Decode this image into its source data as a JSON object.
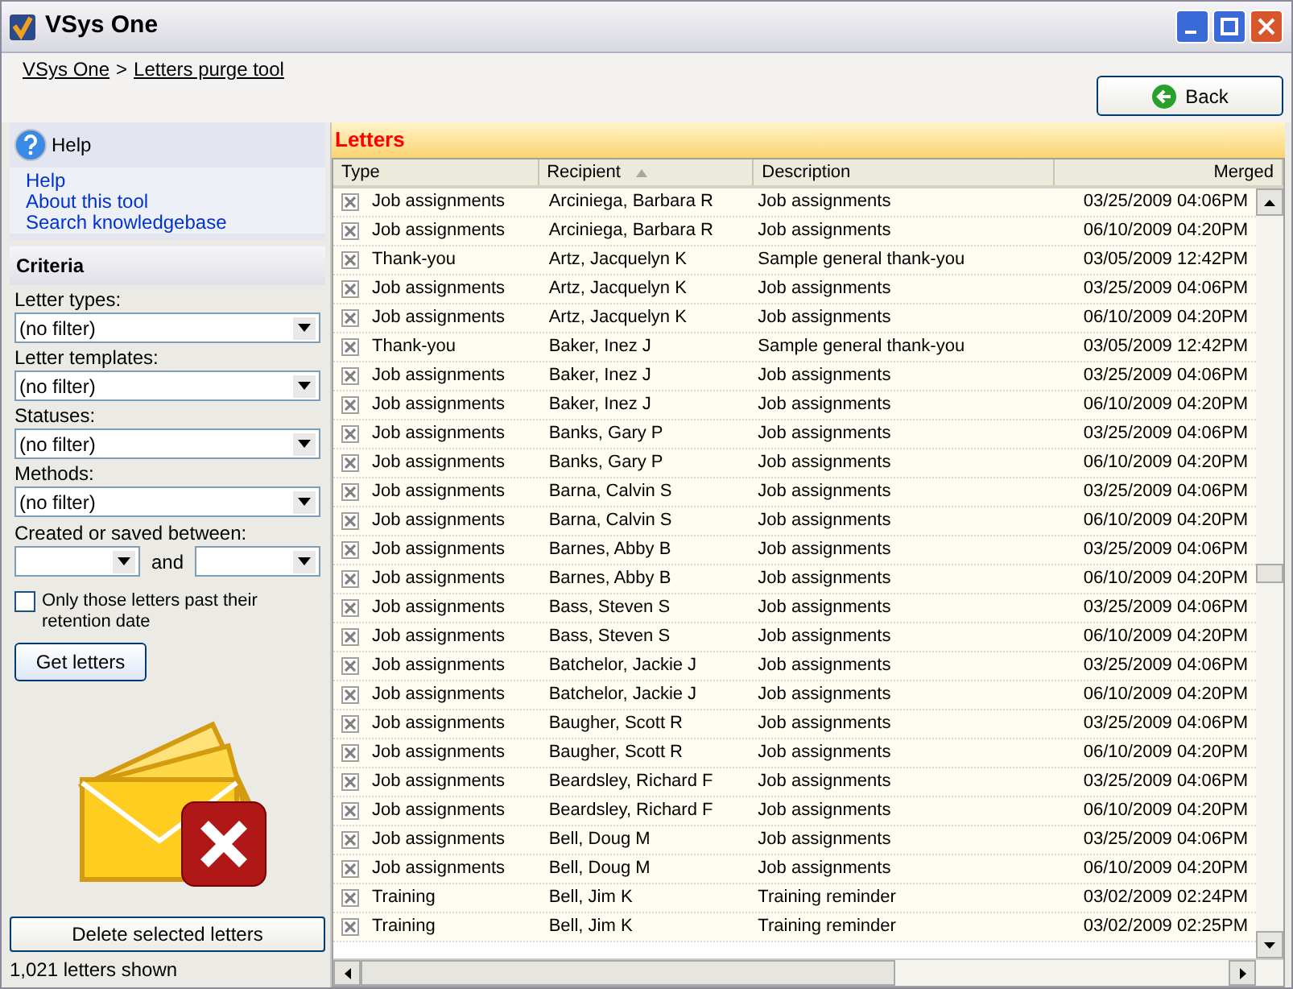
{
  "window": {
    "title": "VSys One"
  },
  "breadcrumb": [
    {
      "label": "VSys One"
    },
    {
      "label": "Letters purge tool"
    }
  ],
  "breadcrumb_separator": ">",
  "back_button": "Back",
  "help": {
    "title": "Help",
    "links": [
      "Help",
      "About this tool",
      "Search knowledgebase"
    ]
  },
  "criteria": {
    "title": "Criteria",
    "filters": [
      {
        "label": "Letter types:",
        "value": "(no filter)"
      },
      {
        "label": "Letter templates:",
        "value": "(no filter)"
      },
      {
        "label": "Statuses:",
        "value": "(no filter)"
      },
      {
        "label": "Methods:",
        "value": "(no filter)"
      }
    ],
    "date_label": "Created or saved between:",
    "date_and": "and",
    "retention": {
      "label": "Only those letters past their retention date",
      "checked": false
    },
    "get_button": "Get letters"
  },
  "delete_button": "Delete selected letters",
  "status": "1,021 letters shown",
  "letters": {
    "title": "Letters",
    "columns": [
      {
        "label": "Type",
        "sorted": false
      },
      {
        "label": "Recipient",
        "sorted": true
      },
      {
        "label": "Description",
        "sorted": false
      },
      {
        "label": "Merged",
        "sorted": false
      }
    ],
    "rows": [
      {
        "checked": true,
        "type": "Job assignments",
        "recipient": "Arciniega, Barbara R",
        "description": "Job assignments",
        "merged": "03/25/2009 04:06PM"
      },
      {
        "checked": true,
        "type": "Job assignments",
        "recipient": "Arciniega, Barbara R",
        "description": "Job assignments",
        "merged": "06/10/2009 04:20PM"
      },
      {
        "checked": true,
        "type": "Thank-you",
        "recipient": "Artz, Jacquelyn K",
        "description": "Sample general thank-you",
        "merged": "03/05/2009 12:42PM"
      },
      {
        "checked": true,
        "type": "Job assignments",
        "recipient": "Artz, Jacquelyn K",
        "description": "Job assignments",
        "merged": "03/25/2009 04:06PM"
      },
      {
        "checked": true,
        "type": "Job assignments",
        "recipient": "Artz, Jacquelyn K",
        "description": "Job assignments",
        "merged": "06/10/2009 04:20PM"
      },
      {
        "checked": true,
        "type": "Thank-you",
        "recipient": "Baker, Inez J",
        "description": "Sample general thank-you",
        "merged": "03/05/2009 12:42PM"
      },
      {
        "checked": true,
        "type": "Job assignments",
        "recipient": "Baker, Inez J",
        "description": "Job assignments",
        "merged": "03/25/2009 04:06PM"
      },
      {
        "checked": true,
        "type": "Job assignments",
        "recipient": "Baker, Inez J",
        "description": "Job assignments",
        "merged": "06/10/2009 04:20PM"
      },
      {
        "checked": true,
        "type": "Job assignments",
        "recipient": "Banks, Gary P",
        "description": "Job assignments",
        "merged": "03/25/2009 04:06PM"
      },
      {
        "checked": true,
        "type": "Job assignments",
        "recipient": "Banks, Gary P",
        "description": "Job assignments",
        "merged": "06/10/2009 04:20PM"
      },
      {
        "checked": true,
        "type": "Job assignments",
        "recipient": "Barna, Calvin S",
        "description": "Job assignments",
        "merged": "03/25/2009 04:06PM"
      },
      {
        "checked": true,
        "type": "Job assignments",
        "recipient": "Barna, Calvin S",
        "description": "Job assignments",
        "merged": "06/10/2009 04:20PM"
      },
      {
        "checked": true,
        "type": "Job assignments",
        "recipient": "Barnes, Abby B",
        "description": "Job assignments",
        "merged": "03/25/2009 04:06PM"
      },
      {
        "checked": true,
        "type": "Job assignments",
        "recipient": "Barnes, Abby B",
        "description": "Job assignments",
        "merged": "06/10/2009 04:20PM"
      },
      {
        "checked": true,
        "type": "Job assignments",
        "recipient": "Bass, Steven S",
        "description": "Job assignments",
        "merged": "03/25/2009 04:06PM"
      },
      {
        "checked": true,
        "type": "Job assignments",
        "recipient": "Bass, Steven S",
        "description": "Job assignments",
        "merged": "06/10/2009 04:20PM"
      },
      {
        "checked": true,
        "type": "Job assignments",
        "recipient": "Batchelor, Jackie J",
        "description": "Job assignments",
        "merged": "03/25/2009 04:06PM"
      },
      {
        "checked": true,
        "type": "Job assignments",
        "recipient": "Batchelor, Jackie J",
        "description": "Job assignments",
        "merged": "06/10/2009 04:20PM"
      },
      {
        "checked": true,
        "type": "Job assignments",
        "recipient": "Baugher, Scott R",
        "description": "Job assignments",
        "merged": "03/25/2009 04:06PM"
      },
      {
        "checked": true,
        "type": "Job assignments",
        "recipient": "Baugher, Scott R",
        "description": "Job assignments",
        "merged": "06/10/2009 04:20PM"
      },
      {
        "checked": true,
        "type": "Job assignments",
        "recipient": "Beardsley, Richard F",
        "description": "Job assignments",
        "merged": "03/25/2009 04:06PM"
      },
      {
        "checked": true,
        "type": "Job assignments",
        "recipient": "Beardsley, Richard F",
        "description": "Job assignments",
        "merged": "06/10/2009 04:20PM"
      },
      {
        "checked": true,
        "type": "Job assignments",
        "recipient": "Bell, Doug M",
        "description": "Job assignments",
        "merged": "03/25/2009 04:06PM"
      },
      {
        "checked": true,
        "type": "Job assignments",
        "recipient": "Bell, Doug M",
        "description": "Job assignments",
        "merged": "06/10/2009 04:20PM"
      },
      {
        "checked": true,
        "type": "Training",
        "recipient": "Bell, Jim K",
        "description": "Training reminder",
        "merged": "03/02/2009 02:24PM"
      },
      {
        "checked": true,
        "type": "Training",
        "recipient": "Bell, Jim K",
        "description": "Training reminder",
        "merged": "03/02/2009 02:25PM"
      }
    ]
  }
}
